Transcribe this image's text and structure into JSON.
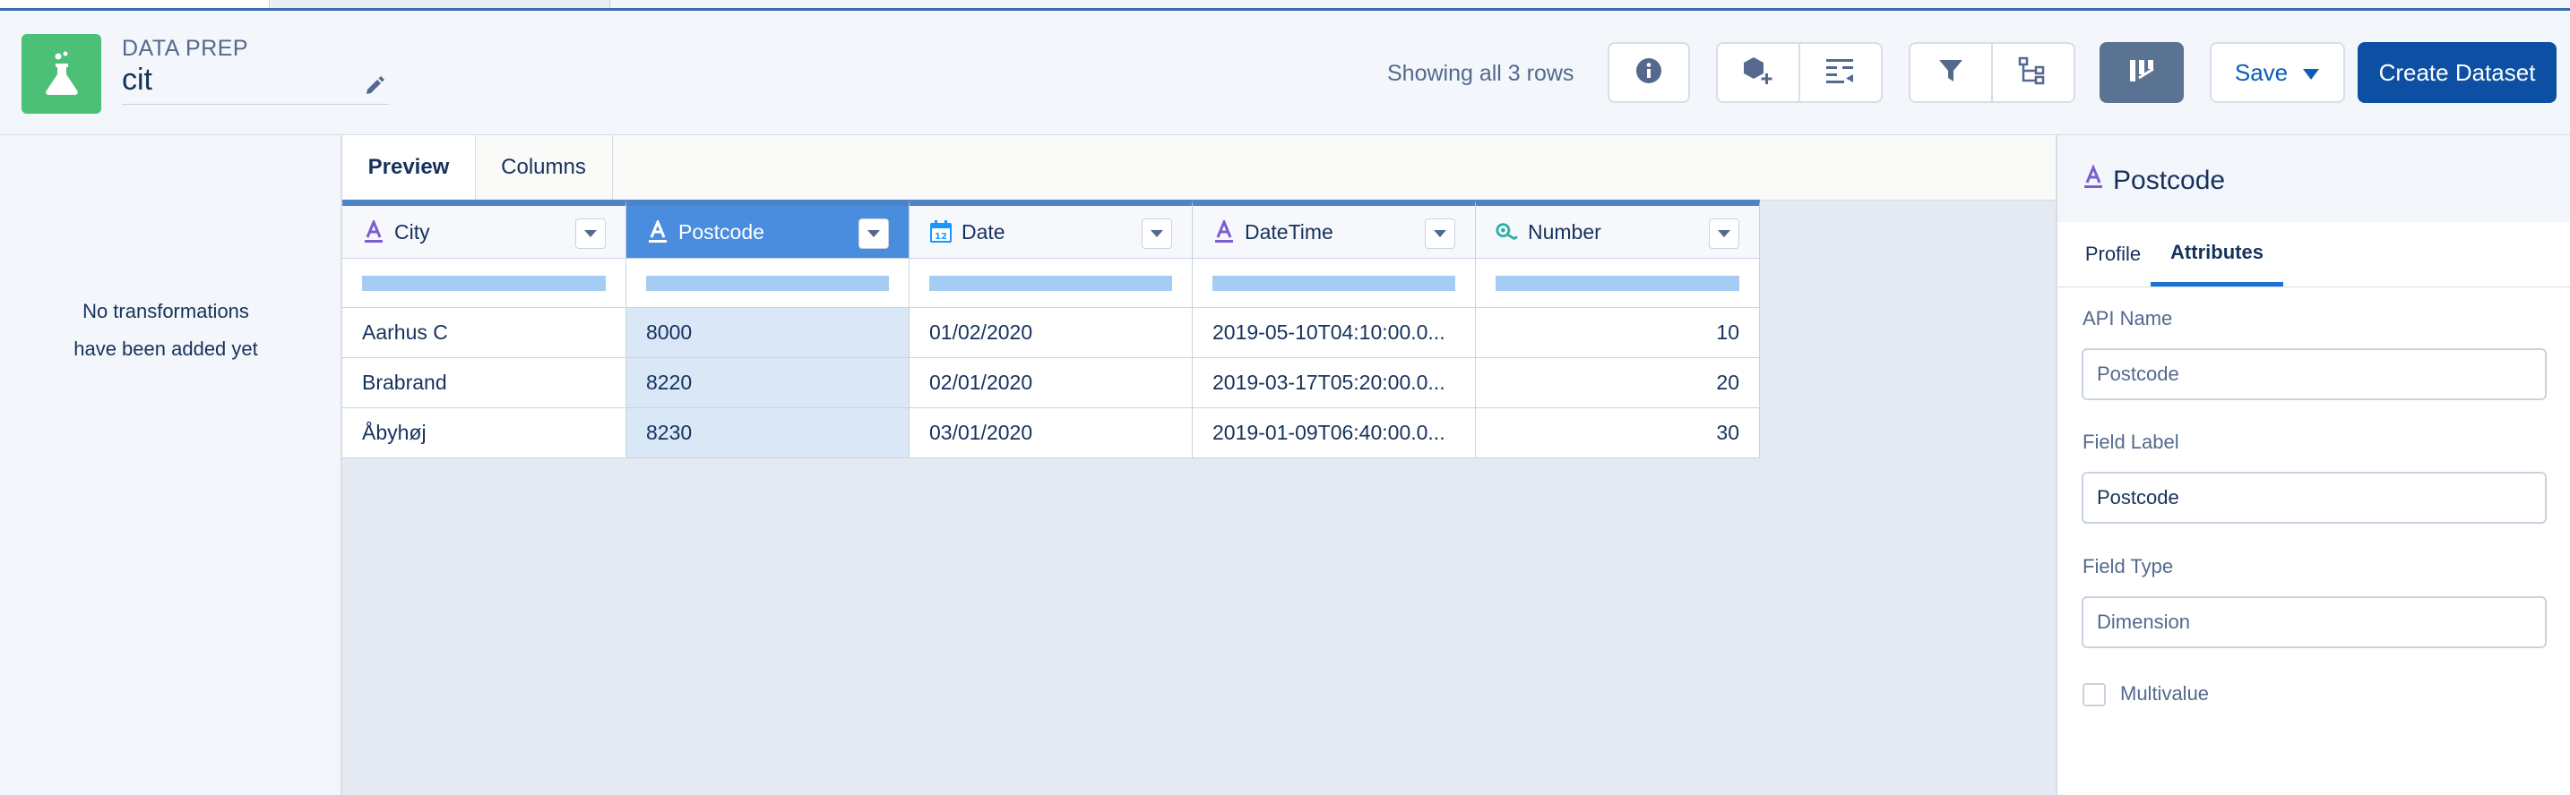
{
  "header": {
    "app_label": "DATA PREP",
    "title": "cit",
    "status_text": "Showing all 3 rows",
    "save_label": "Save",
    "create_dataset_label": "Create Dataset"
  },
  "left_panel": {
    "empty_line1": "No transformations",
    "empty_line2": "have been added yet"
  },
  "center": {
    "tabs": [
      {
        "label": "Preview",
        "active": true
      },
      {
        "label": "Columns",
        "active": false
      }
    ],
    "columns": [
      {
        "label": "City",
        "type_icon": "text-type-icon"
      },
      {
        "label": "Postcode",
        "type_icon": "text-type-icon",
        "selected": true
      },
      {
        "label": "Date",
        "type_icon": "calendar-type-icon"
      },
      {
        "label": "DateTime",
        "type_icon": "text-type-icon"
      },
      {
        "label": "Number",
        "type_icon": "number-type-icon"
      }
    ],
    "rows": [
      [
        "Aarhus C",
        "8000",
        "01/02/2020",
        "2019-05-10T04:10:00.0...",
        "10"
      ],
      [
        "Brabrand",
        "8220",
        "02/01/2020",
        "2019-03-17T05:20:00.0...",
        "20"
      ],
      [
        "Åbyhøj",
        "8230",
        "03/01/2020",
        "2019-01-09T06:40:00.0...",
        "30"
      ]
    ],
    "calendar_day": "12"
  },
  "right_panel": {
    "title": "Postcode",
    "tabs": [
      {
        "label": "Profile",
        "active": false
      },
      {
        "label": "Attributes",
        "active": true
      }
    ],
    "api_name_label": "API Name",
    "api_name_placeholder": "Postcode",
    "field_label_label": "Field Label",
    "field_label_value": "Postcode",
    "field_type_label": "Field Type",
    "field_type_placeholder": "Dimension",
    "multivalue_label": "Multivalue"
  },
  "colors": {
    "accent": "#0d4fa3",
    "app_icon": "#4bc076",
    "selected_column": "#4a8dde",
    "quality_bar": "#a5cdf3"
  }
}
